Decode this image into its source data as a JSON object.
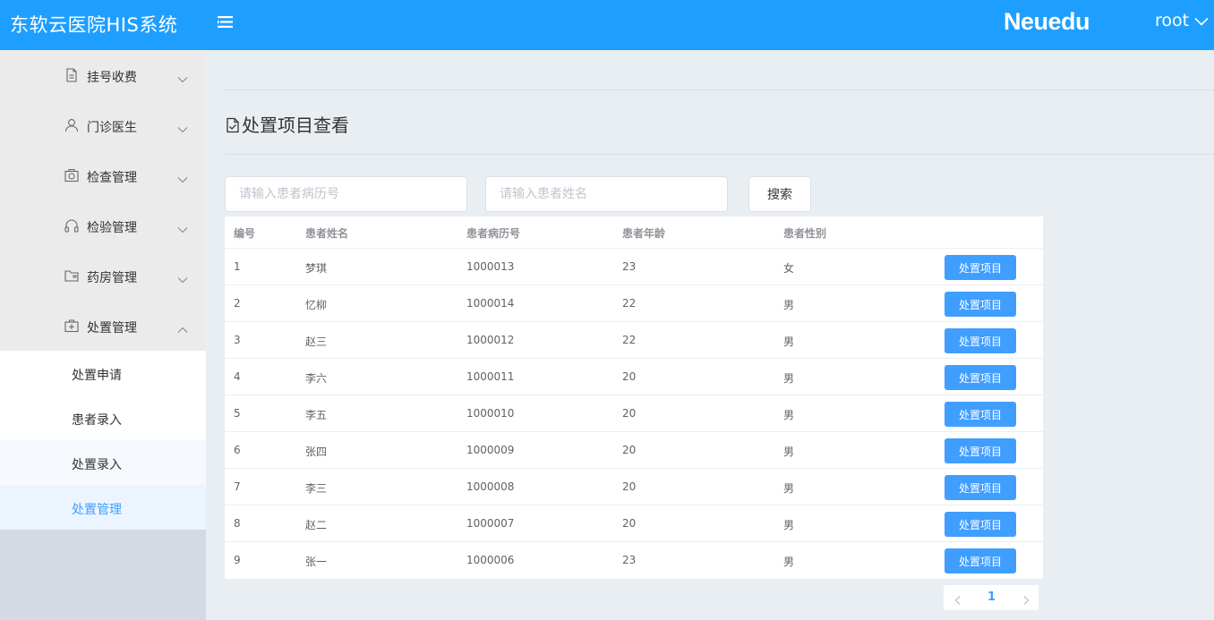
{
  "header": {
    "app_title": "东软云医院HIS系统",
    "logo": "Neuedu",
    "user": "root",
    "bg_color": "#1e9fff"
  },
  "sidebar": {
    "groups": [
      {
        "label": "挂号收费",
        "icon": "document-icon"
      },
      {
        "label": "门诊医生",
        "icon": "user-icon"
      },
      {
        "label": "检查管理",
        "icon": "camera-icon"
      },
      {
        "label": "检验管理",
        "icon": "headphones-icon"
      },
      {
        "label": "药房管理",
        "icon": "folder-icon"
      },
      {
        "label": "处置管理",
        "icon": "medkit-icon",
        "expanded": true
      }
    ],
    "subitems": [
      {
        "label": "处置申请"
      },
      {
        "label": "患者录入"
      },
      {
        "label": "处置录入"
      },
      {
        "label": "处置管理",
        "active": true
      }
    ]
  },
  "page": {
    "title": "处置项目查看"
  },
  "search": {
    "record_placeholder": "请输入患者病历号",
    "name_placeholder": "请输入患者姓名",
    "button_label": "搜索"
  },
  "table": {
    "columns": [
      "编号",
      "患者姓名",
      "患者病历号",
      "患者年龄",
      "患者性别"
    ],
    "action_label": "处置项目",
    "rows": [
      [
        "1",
        "梦琪",
        "1000013",
        "23",
        "女"
      ],
      [
        "2",
        "忆柳",
        "1000014",
        "22",
        "男"
      ],
      [
        "3",
        "赵三",
        "1000012",
        "22",
        "男"
      ],
      [
        "4",
        "李六",
        "1000011",
        "20",
        "男"
      ],
      [
        "5",
        "李五",
        "1000010",
        "20",
        "男"
      ],
      [
        "6",
        "张四",
        "1000009",
        "20",
        "男"
      ],
      [
        "7",
        "李三",
        "1000008",
        "20",
        "男"
      ],
      [
        "8",
        "赵二",
        "1000007",
        "20",
        "男"
      ],
      [
        "9",
        "张一",
        "1000006",
        "23",
        "男"
      ]
    ]
  },
  "pagination": {
    "current_page": "1"
  },
  "colors": {
    "accent": "#409eff",
    "sidebar_active_bg": "#ecf5ff"
  }
}
